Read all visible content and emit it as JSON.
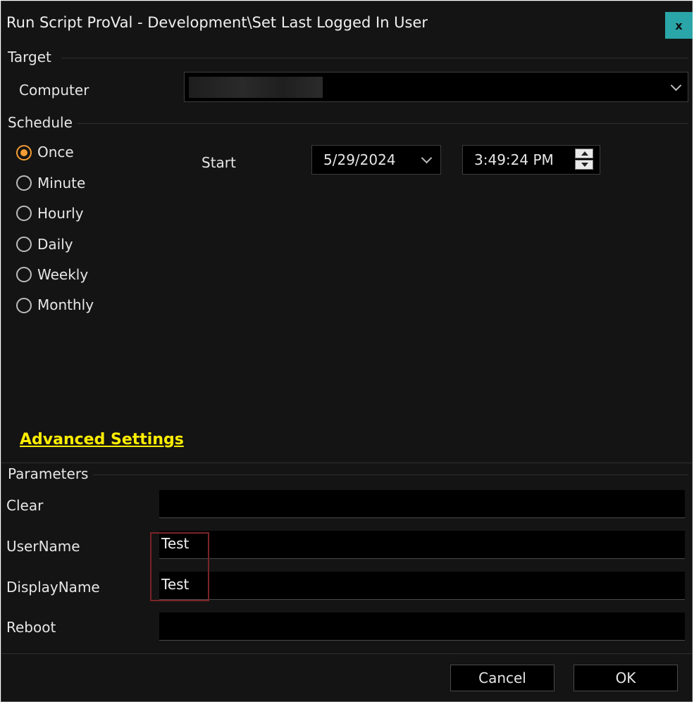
{
  "window": {
    "title": "Run Script ProVal - Development\\Set Last Logged In User",
    "close_label": "x"
  },
  "target": {
    "group_label": "Target",
    "computer_label": "Computer",
    "computer_value": ""
  },
  "schedule": {
    "group_label": "Schedule",
    "options": [
      {
        "label": "Once",
        "selected": true
      },
      {
        "label": "Minute",
        "selected": false
      },
      {
        "label": "Hourly",
        "selected": false
      },
      {
        "label": "Daily",
        "selected": false
      },
      {
        "label": "Weekly",
        "selected": false
      },
      {
        "label": "Monthly",
        "selected": false
      }
    ],
    "start_label": "Start",
    "start_date": "5/29/2024",
    "start_time": "3:49:24 PM"
  },
  "advanced_settings_label": "Advanced Settings",
  "parameters": {
    "group_label": "Parameters",
    "items": [
      {
        "label": "Clear",
        "value": ""
      },
      {
        "label": "UserName",
        "value": "Test"
      },
      {
        "label": "DisplayName",
        "value": "Test"
      },
      {
        "label": "Reboot",
        "value": ""
      }
    ]
  },
  "buttons": {
    "cancel": "Cancel",
    "ok": "OK"
  },
  "colors": {
    "background": "#141414",
    "accent_radio": "#f39c32",
    "close_button": "#2aa5a8",
    "link": "#ffee00",
    "highlight_box": "#7a2426"
  }
}
